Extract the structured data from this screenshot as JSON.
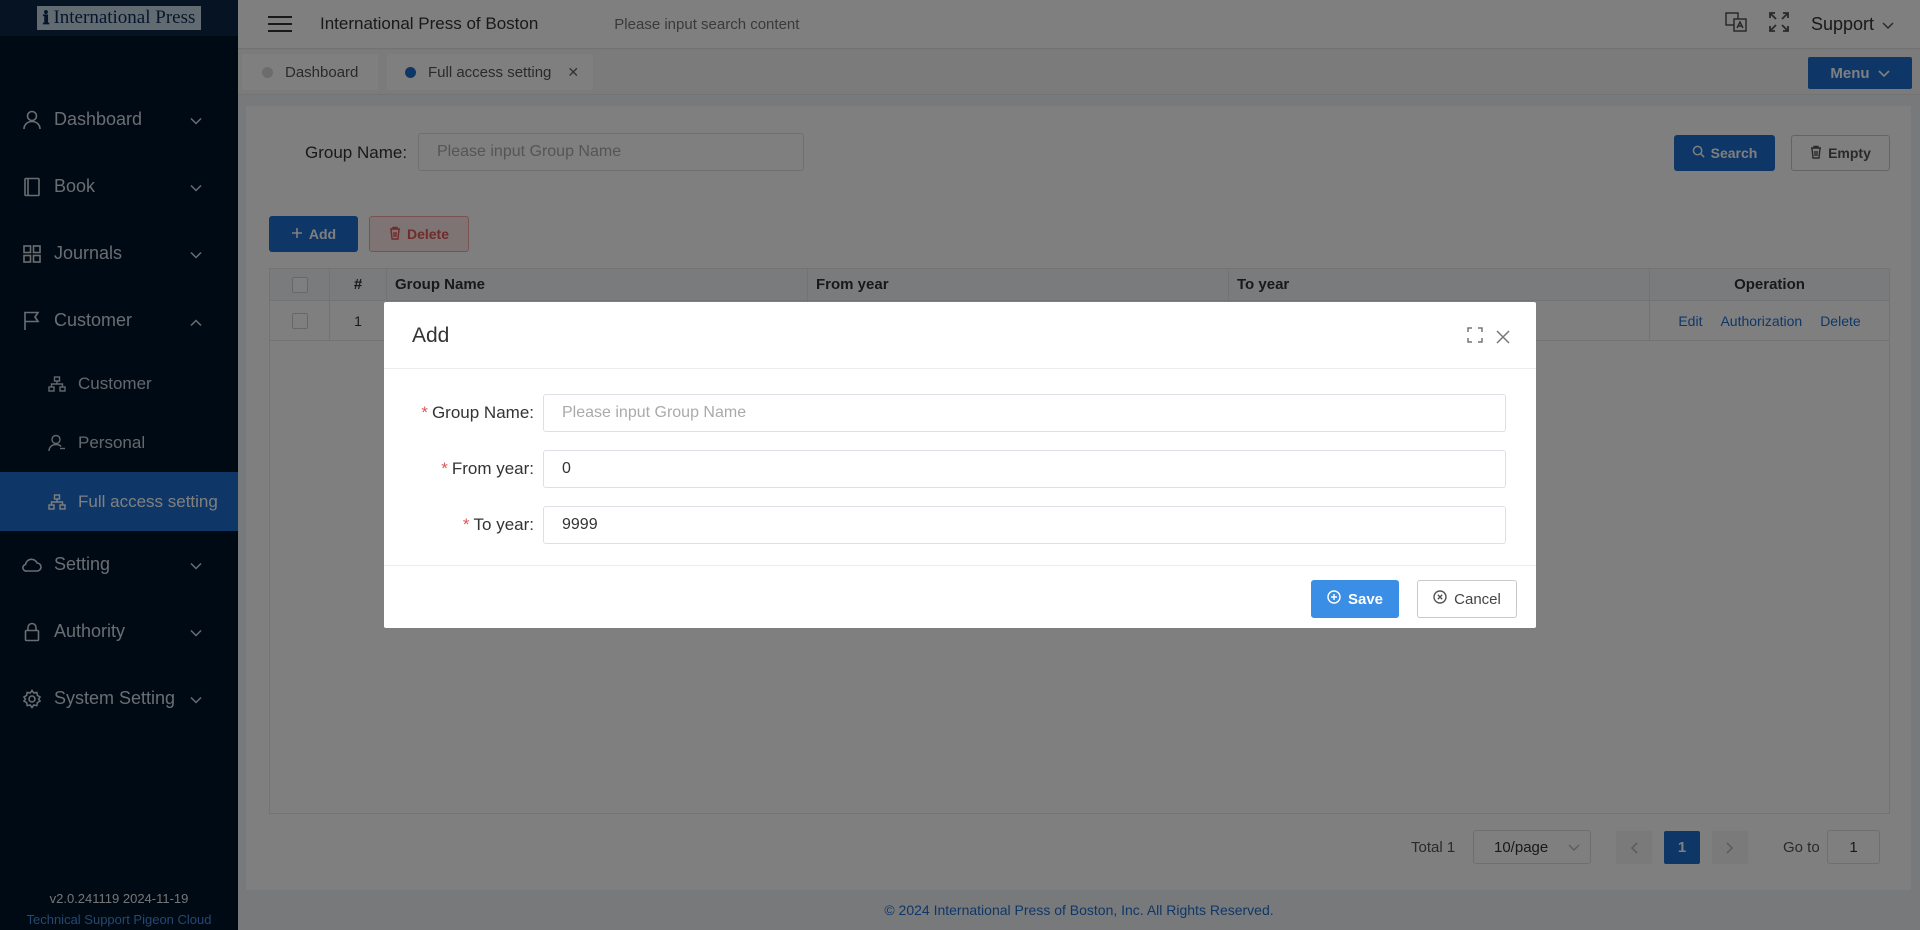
{
  "logo": {
    "text": "International Press"
  },
  "sidebar": {
    "items": [
      {
        "label": "Dashboard",
        "icon": "user-icon"
      },
      {
        "label": "Book",
        "icon": "book-icon"
      },
      {
        "label": "Journals",
        "icon": "grid-icon"
      },
      {
        "label": "Customer",
        "icon": "flag-icon"
      },
      {
        "label": "Setting",
        "icon": "cloud-icon"
      },
      {
        "label": "Authority",
        "icon": "lock-icon"
      },
      {
        "label": "System Setting",
        "icon": "gear-icon"
      }
    ],
    "customer_sub": [
      {
        "label": "Customer",
        "icon": "org-chart-icon"
      },
      {
        "label": "Personal",
        "icon": "person-icon"
      },
      {
        "label": "Full access setting",
        "icon": "org-chart-icon"
      }
    ],
    "version": "v2.0.241119 2024-11-19",
    "tech_support": "Technical Support Pigeon Cloud"
  },
  "header": {
    "site_title": "International Press of Boston",
    "search_placeholder": "Please input search content",
    "support_label": "Support"
  },
  "tabs": [
    {
      "label": "Dashboard"
    },
    {
      "label": "Full access setting"
    }
  ],
  "menu_button": "Menu",
  "filter": {
    "group_name_label": "Group Name:",
    "group_name_placeholder": "Please input Group Name",
    "search_label": "Search",
    "empty_label": "Empty"
  },
  "toolbar": {
    "add_label": "Add",
    "delete_label": "Delete"
  },
  "table": {
    "columns": [
      "#",
      "Group Name",
      "From year",
      "To year",
      "Operation"
    ],
    "rows": [
      {
        "num": "1",
        "actions": [
          "Edit",
          "Authorization",
          "Delete"
        ]
      }
    ]
  },
  "pagination": {
    "total": "Total 1",
    "page_size": "10/page",
    "current_page": "1",
    "goto_label": "Go to",
    "goto_value": "1"
  },
  "footer": "© 2024 International Press of Boston, Inc. All Rights Reserved.",
  "dialog": {
    "title": "Add",
    "fields": [
      {
        "label": "Group Name:",
        "value": "",
        "placeholder": "Please input Group Name"
      },
      {
        "label": "From year:",
        "value": "0"
      },
      {
        "label": "To year:",
        "value": "9999"
      }
    ],
    "save_label": "Save",
    "cancel_label": "Cancel"
  },
  "colors": {
    "primary": "#1d6fd1",
    "sidebar_bg": "#001529",
    "danger": "#e05656"
  }
}
